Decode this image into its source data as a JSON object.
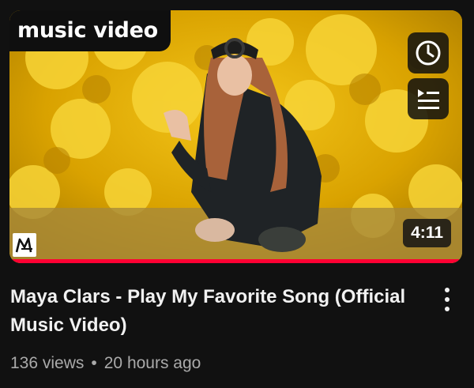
{
  "video": {
    "badge": "music video",
    "duration": "4:11",
    "title": "Maya Clars - Play My Favorite Song (Official Music Video)",
    "views": "136 views",
    "separator": "•",
    "age": "20 hours ago",
    "progress_fraction": 1.0
  },
  "icons": {
    "watch_later": "clock-icon",
    "add_to_queue": "queue-icon",
    "channel_logo": "channel-logo-m",
    "more": "kebab-menu-icon"
  },
  "colors": {
    "background": "#111111",
    "progress": "#ff0033",
    "meta_text": "#aaaaaa"
  }
}
